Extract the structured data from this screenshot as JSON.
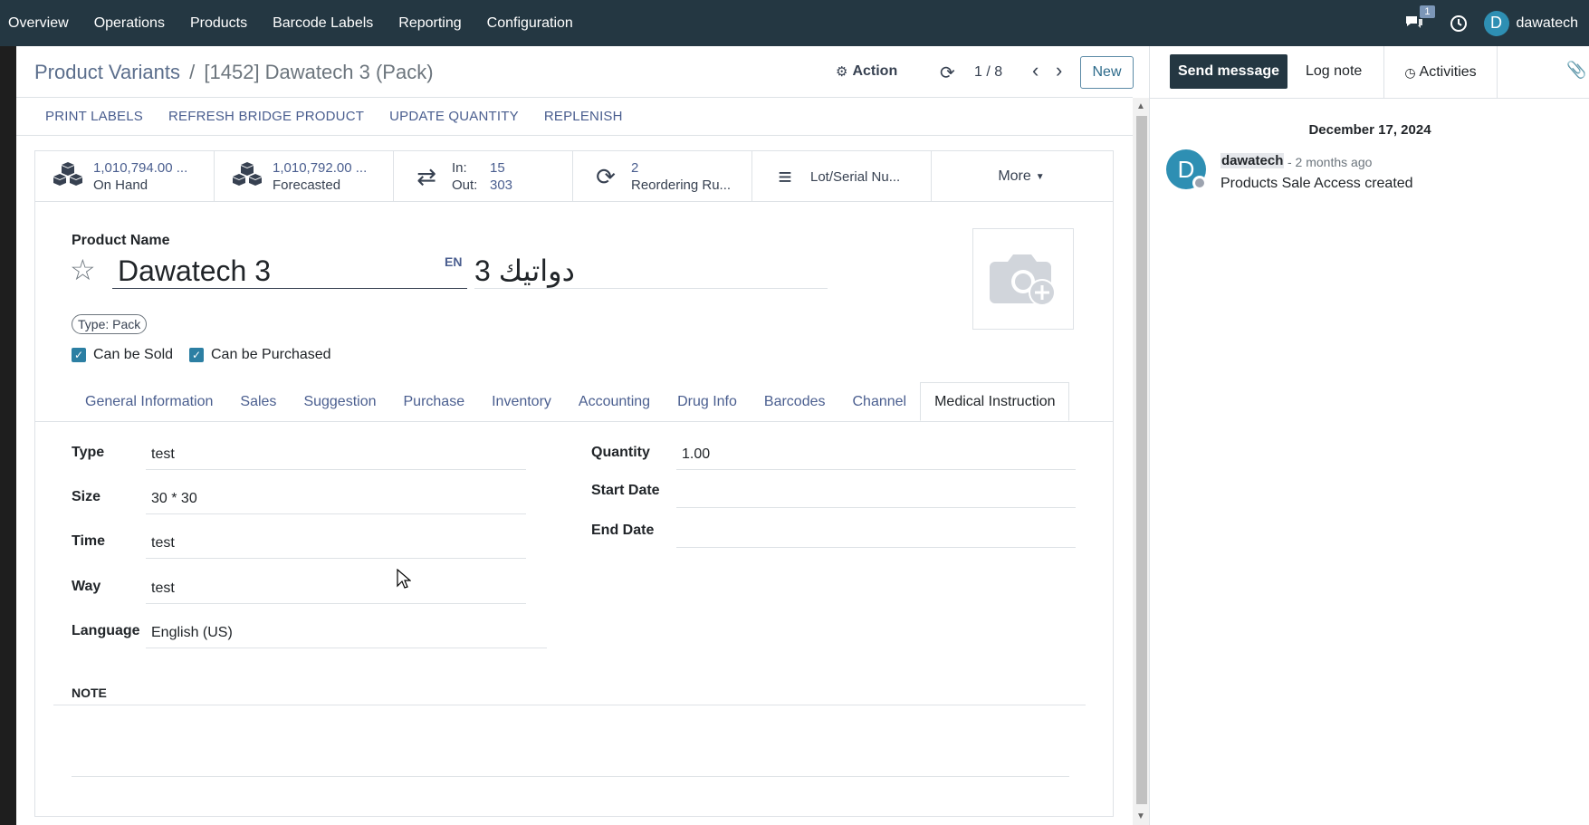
{
  "navbar": {
    "menu": [
      "Overview",
      "Operations",
      "Products",
      "Barcode Labels",
      "Reporting",
      "Configuration"
    ],
    "messages_badge": "1",
    "avatar_letter": "D",
    "username": "dawatech"
  },
  "control": {
    "breadcrumb_parent": "Product Variants",
    "breadcrumb_sep": "/",
    "breadcrumb_current": "[1452] Dawatech 3 (Pack)",
    "action_label": "Action",
    "pager": "1 / 8",
    "new_label": "New"
  },
  "header_buttons": [
    "PRINT LABELS",
    "REFRESH BRIDGE PRODUCT",
    "UPDATE QUANTITY",
    "REPLENISH"
  ],
  "smart_buttons": {
    "on_hand_value": "1,010,794.00 ...",
    "on_hand_label": "On Hand",
    "forecasted_value": "1,010,792.00 ...",
    "forecasted_label": "Forecasted",
    "in_label": "In:",
    "in_value": "15",
    "out_label": "Out:",
    "out_value": "303",
    "reordering_value": "2",
    "reordering_label": "Reordering Ru...",
    "lot_label": "Lot/Serial Nu...",
    "more_label": "More"
  },
  "product": {
    "name_label": "Product Name",
    "name": "Dawatech 3",
    "lang": "EN",
    "name_ar": "دواتيك 3",
    "type_tag": "Type: Pack",
    "can_be_sold": "Can be Sold",
    "can_be_purchased": "Can be Purchased"
  },
  "tabs": [
    "General Information",
    "Sales",
    "Suggestion",
    "Purchase",
    "Inventory",
    "Accounting",
    "Drug Info",
    "Barcodes",
    "Channel",
    "Medical Instruction"
  ],
  "active_tab": "Medical Instruction",
  "fields": {
    "type_label": "Type",
    "type_value": "test",
    "size_label": "Size",
    "size_value": "30 * 30",
    "time_label": "Time",
    "time_value": "test",
    "way_label": "Way",
    "way_value": "test",
    "language_label": "Language",
    "language_value": "English (US)",
    "quantity_label": "Quantity",
    "quantity_value": "1.00",
    "start_date_label": "Start Date",
    "start_date_value": "",
    "end_date_label": "End Date",
    "end_date_value": "",
    "note_label": "NOTE"
  },
  "chatter": {
    "send_message": "Send message",
    "log_note": "Log note",
    "activities": "Activities",
    "date": "December 17, 2024",
    "author": "dawatech",
    "time": "- 2 months ago",
    "body": "Products Sale Access created",
    "avatar_letter": "D"
  },
  "colors": {
    "navbar": "#243742",
    "link": "#4a5e8f",
    "checkbox": "#2c7fa3",
    "avatar": "#2e8fb3"
  }
}
